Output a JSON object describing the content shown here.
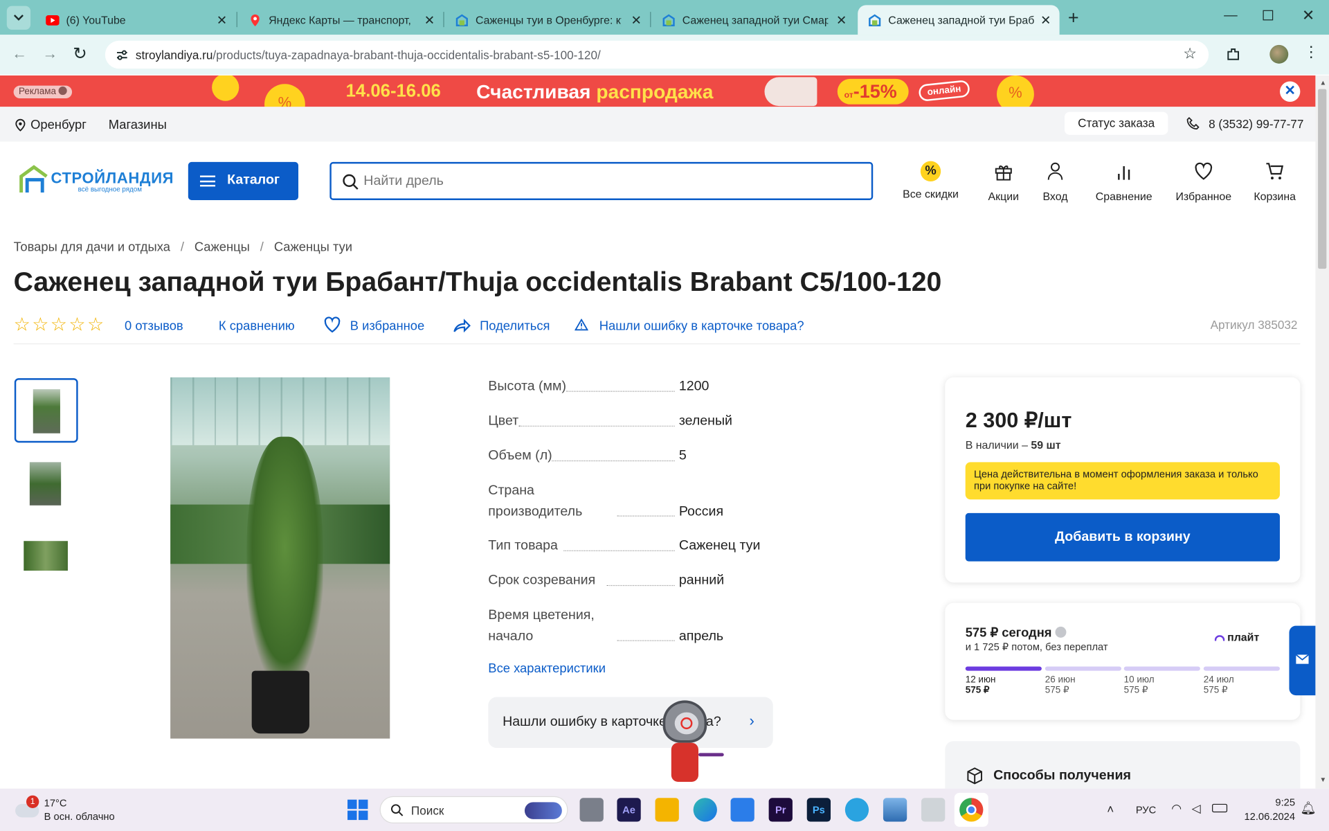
{
  "browser": {
    "tabs": [
      {
        "title": "(6) YouTube"
      },
      {
        "title": "Яндекс Карты — транспорт, на"
      },
      {
        "title": "Саженцы туи в Оренбурге: куп"
      },
      {
        "title": "Саженец западной туи Смараг"
      },
      {
        "title": "Саженец западной туи Брабан"
      }
    ],
    "url_host": "stroylandiya.ru",
    "url_path": "/products/tuya-zapadnaya-brabant-thuja-occidentalis-brabant-s5-100-120/"
  },
  "ad": {
    "label": "Реклама",
    "dates": "14.06-16.06",
    "text1": "Счастливая",
    "text2": "распродажа",
    "discount_prefix": "от",
    "discount": "-15%",
    "online": "онлайн"
  },
  "topbar": {
    "city": "Оренбург",
    "stores": "Магазины",
    "order_status": "Статус заказа",
    "phone": "8 (3532) 99-77-77"
  },
  "header": {
    "logo": "СТРОЙЛАНДИЯ",
    "logo_tagline": "всё выгодное рядом",
    "catalog": "Каталог",
    "search_placeholder": "Найти дрель",
    "nav": [
      "Все скидки",
      "Акции",
      "Вход",
      "Сравнение",
      "Избранное",
      "Корзина"
    ]
  },
  "breadcrumbs": [
    "Товары для дачи и отдыха",
    "Саженцы",
    "Саженцы туи"
  ],
  "product": {
    "title": "Саженец западной туи Брабант/Thuja occidentalis Brabant C5/100-120",
    "reviews": "0 отзывов",
    "compare": "К сравнению",
    "favorite": "В избранное",
    "share": "Поделиться",
    "report": "Нашли ошибку в карточке товара?",
    "sku": "Артикул 385032",
    "specs": [
      {
        "name": "Высота (мм)",
        "value": "1200"
      },
      {
        "name": "Цвет",
        "value": "зеленый"
      },
      {
        "name": "Объем (л)",
        "value": "5"
      },
      {
        "name1": "Страна",
        "name2": "производитель",
        "value": "Россия"
      },
      {
        "name": "Тип товара",
        "value": "Саженец туи"
      },
      {
        "name": "Срок созревания",
        "value": "ранний"
      },
      {
        "name1": "Время цветения,",
        "name2": "начало",
        "value": "апрель"
      }
    ],
    "all_specs": "Все характеристики",
    "error_box": "Нашли ошибку в карточке товара?"
  },
  "price": {
    "value": "2 300 ₽/шт",
    "stock_label": "В наличии –",
    "stock_count": "59 шт",
    "note": "Цена действительна в момент оформления заказа и только при покупке на сайте!",
    "add_to_cart": "Добавить в корзину"
  },
  "installments": {
    "today": "575 ₽ сегодня",
    "rest": "и 1 725 ₽ потом, без переплат",
    "brand": "плайт",
    "payments": [
      {
        "date": "12 июн",
        "amount": "575 ₽"
      },
      {
        "date": "26 июн",
        "amount": "575 ₽"
      },
      {
        "date": "10 июл",
        "amount": "575 ₽"
      },
      {
        "date": "24 июл",
        "amount": "575 ₽"
      }
    ]
  },
  "delivery": {
    "title": "Способы получения"
  },
  "taskbar": {
    "weather_temp": "17°C",
    "weather_text": "В осн. облачно",
    "weather_badge": "1",
    "search": "Поиск",
    "lang": "РУС",
    "time": "9:25",
    "date": "12.06.2024"
  },
  "colors": {
    "brand_blue": "#0b5cc8",
    "note_yellow": "#ffdc2e",
    "ad_red": "#ef4a45",
    "tab_teal": "#7fc9c5"
  }
}
